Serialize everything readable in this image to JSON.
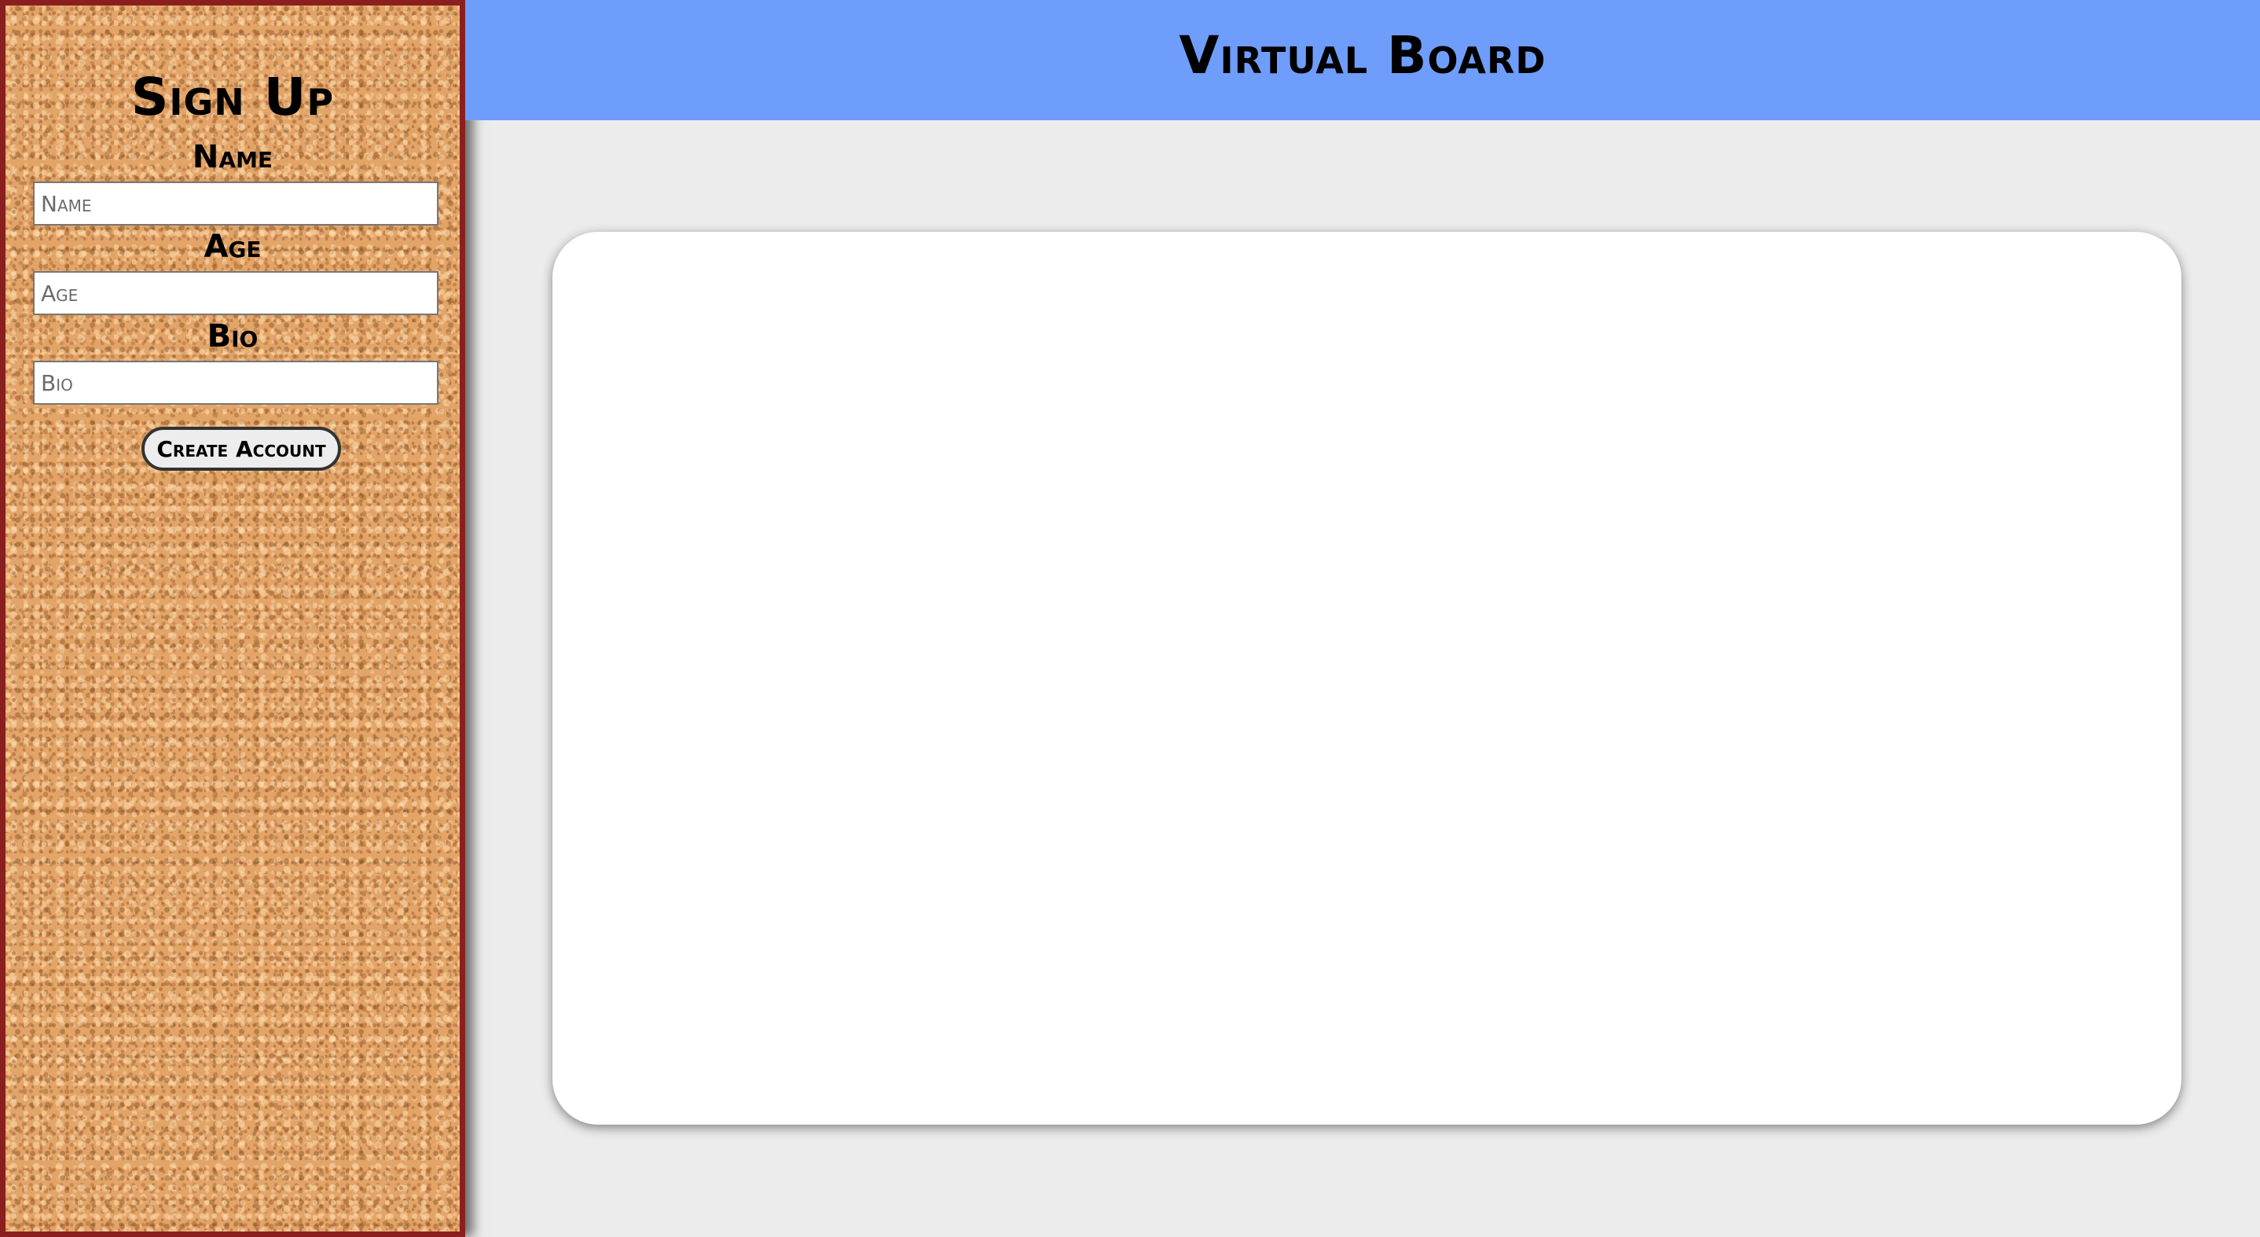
{
  "header": {
    "title": "Virtual Board"
  },
  "signup": {
    "title": "Sign Up",
    "fields": [
      {
        "label": "Name",
        "placeholder": "Name",
        "value": ""
      },
      {
        "label": "Age",
        "placeholder": "Age",
        "value": ""
      },
      {
        "label": "Bio",
        "placeholder": "Bio",
        "value": ""
      }
    ],
    "submit_label": "Create Account"
  },
  "colors": {
    "header_bg": "#6f9dfb",
    "sidebar_border": "#8a1f1f",
    "cork": "#e3a468",
    "page_bg": "#ececec"
  }
}
